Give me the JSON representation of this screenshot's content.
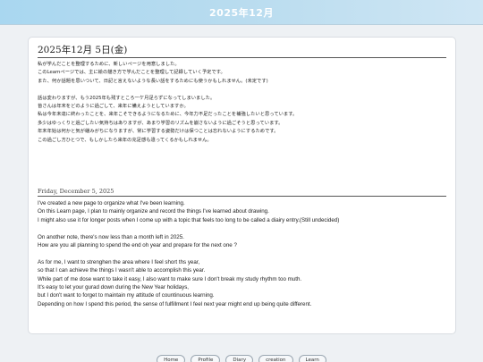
{
  "header": {
    "title": "2025年12月"
  },
  "entry_jp": {
    "title": "2025年12月 5日(金)",
    "lines": [
      "私が学んだことを整理するために、新しいページを用意しました。",
      "このLearnページでは、主に絵の描き方で学んだことを整理して記録していく予定です。",
      "また、何か話題を思いついて、日記と言えないような長い話をするためにも使うかもしれません。(未定です)",
      "",
      "話は変わりますが、もう2025年も残すところ一ケ月足らずになってしまいました。",
      "皆さんは年末をどのように過ごして、来年に備えようとしていますか。",
      "私は今年未達に終わったことを、来年こそできるようになるために、今年力不足だったことを補強したいと思っています。",
      "多少はゆっくりと過ごしたい気持ちはありますが、あまり学習のリズムを崩さないように過ごそうと思っています。",
      "年末年始は何かと気が緩みがちになりますが、常に学習する姿勢だけは保つことは忘れないようにするためです。",
      "この過ごし方ひとつで、もしかしたら来年の充足感も違ってくるかもしれません。"
    ]
  },
  "entry_en": {
    "title": "Friday, December 5, 2025",
    "lines": [
      "I've created a new page to organize what I've been learning.",
      "On this Learn page, I plan to mainly organize and record the things I've learned about drawing.",
      "I might also use it for longer posts when I come up with a topic that feels too long to be called a diairy entry.(Still undecided)",
      "",
      "On another note, there's now less than a month left in 2025.",
      "How are you all planning to spend the end oh year and prepare for the next one ?",
      "",
      "As for me, I want to strenghen the area where I feel short ths year,",
      "so that I can achieve the things I wasn't able to accomplish this year.",
      "While part of me dose want to take it easy, I also want to make sure I don't break my study rhythm too muth.",
      "It's easy to let your gurad down during the New Year holidays,",
      "but I don't want to forget to maintain my attitude of countinuous learning.",
      "Depending on how I spend this period, the sense of fulfillment I feel next year might end up being quite different."
    ]
  },
  "footer_nav": [
    "Home",
    "Profile",
    "Diary",
    "creation",
    "Learn"
  ]
}
